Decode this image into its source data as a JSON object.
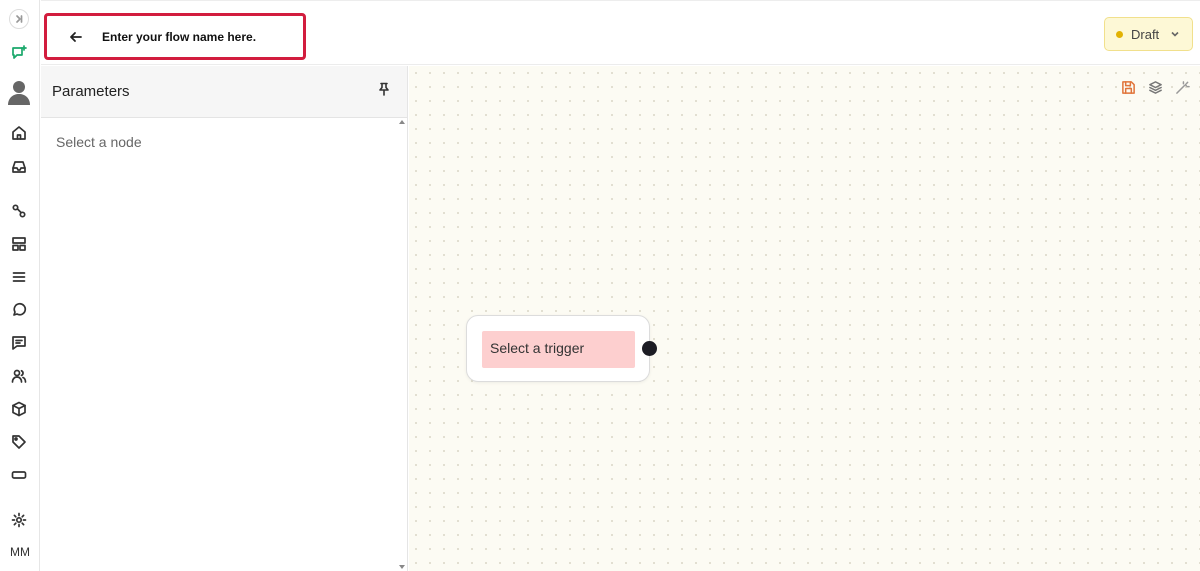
{
  "header": {
    "flow_name_placeholder": "Enter your flow name here.",
    "status_label": "Draft",
    "status_color": "#e2b203"
  },
  "sidebar": {
    "icons": [
      "collapse-icon",
      "flow-chat-icon",
      "avatar",
      "home-icon",
      "inbox-icon",
      "workflow-icon",
      "layout-icon",
      "menu-icon",
      "chat-icon",
      "message-icon",
      "users-icon",
      "package-icon",
      "tag-icon",
      "rectangle-icon",
      "settings-icon"
    ],
    "user_initials": "MM"
  },
  "params": {
    "title": "Parameters",
    "empty_text": "Select a node"
  },
  "canvas": {
    "trigger_label": "Select a trigger",
    "trigger_color": "#fdcfcf",
    "tools": [
      "save-icon",
      "layers-icon",
      "magic-wand-icon"
    ]
  },
  "colors": {
    "highlight_border": "#d21d3e",
    "canvas_bg": "#fcfbf3"
  }
}
